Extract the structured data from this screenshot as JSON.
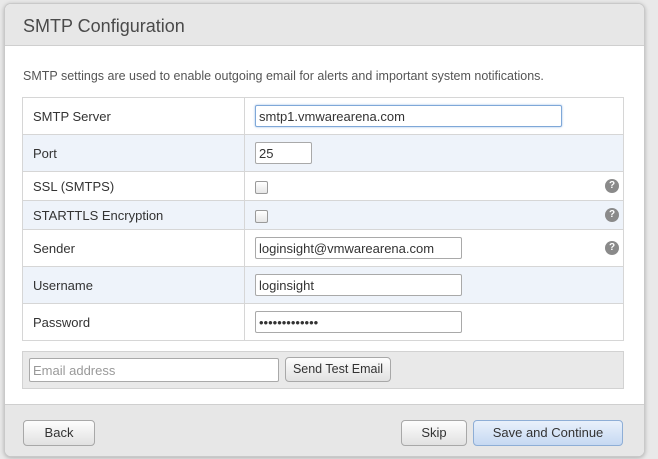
{
  "dialog": {
    "title": "SMTP Configuration",
    "description": "SMTP settings are used to enable outgoing email for alerts and important system notifications."
  },
  "fields": {
    "smtp_server": {
      "label": "SMTP Server",
      "value": "smtp1.vmwarearena.com"
    },
    "port": {
      "label": "Port",
      "value": "25"
    },
    "ssl": {
      "label": "SSL (SMTPS)",
      "checked": false
    },
    "starttls": {
      "label": "STARTTLS Encryption",
      "checked": false
    },
    "sender": {
      "label": "Sender",
      "value": "loginsight@vmwarearena.com"
    },
    "username": {
      "label": "Username",
      "value": "loginsight"
    },
    "password": {
      "label": "Password",
      "value": "•••••••••••••"
    }
  },
  "help_glyph": "?",
  "test_email": {
    "placeholder": "Email address",
    "button_label": "Send Test Email"
  },
  "footer": {
    "back_label": "Back",
    "skip_label": "Skip",
    "save_label": "Save and Continue"
  },
  "colors": {
    "alt_row": "#eef3fa",
    "primary_button": "#c6d9f2",
    "help_icon": "#8a8a8a"
  }
}
